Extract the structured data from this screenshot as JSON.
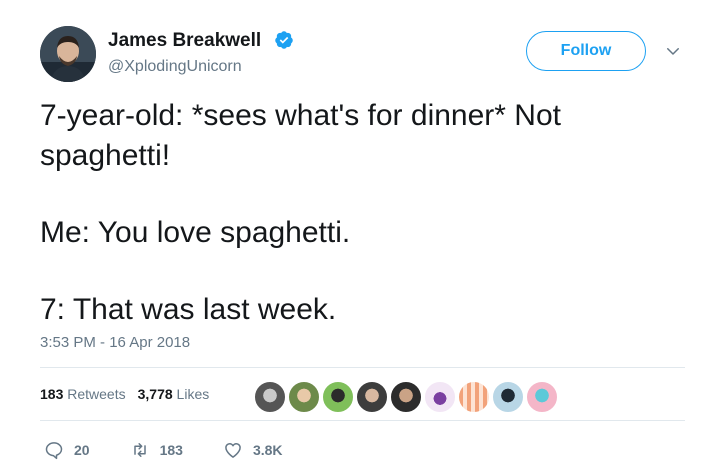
{
  "author": {
    "name": "James Breakwell",
    "handle": "@XplodingUnicorn"
  },
  "header": {
    "follow_label": "Follow"
  },
  "tweet": {
    "paragraphs": [
      "7-year-old: *sees what's for dinner* Not spaghetti!",
      "Me: You love spaghetti.",
      "7: That was last week."
    ],
    "timestamp": "3:53 PM - 16 Apr 2018"
  },
  "stats": {
    "retweets_count": "183",
    "retweets_label": "Retweets",
    "likes_count": "3,778",
    "likes_label": "Likes"
  },
  "actions": {
    "reply_count": "20",
    "retweet_count": "183",
    "like_count": "3.8K"
  },
  "colors": {
    "accent": "#1da1f2",
    "secondary_text": "#657786",
    "divider": "#e1e8ed"
  },
  "icons": [
    "verified-badge-icon",
    "chevron-down-icon",
    "reply-icon",
    "retweet-icon",
    "heart-icon"
  ]
}
